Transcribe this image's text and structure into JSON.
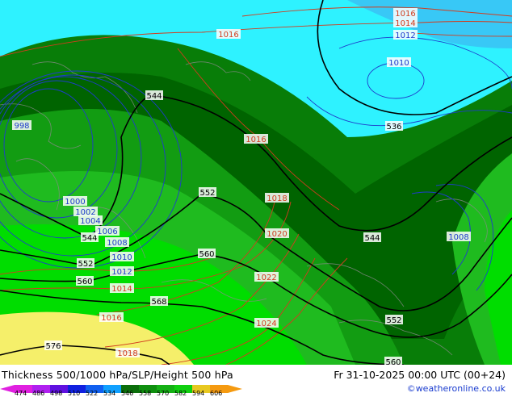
{
  "map": {
    "contour_labels_500hpa": [
      "544",
      "544",
      "544",
      "552",
      "552",
      "552",
      "560",
      "560",
      "560",
      "568",
      "576",
      "536"
    ],
    "contour_labels_slp": [
      "1016",
      "1016",
      "1016",
      "1014",
      "1014",
      "1012",
      "1012",
      "1010",
      "1010",
      "1008",
      "1008",
      "1008",
      "1006",
      "1004",
      "1002",
      "1000",
      "998",
      "1018",
      "1018",
      "1020",
      "1022",
      "1024"
    ],
    "colors": {
      "cyan": "#2ef2ff",
      "lightblue": "#38c8f6",
      "darkgreen": "#006400",
      "green1": "#087d08",
      "green2": "#129c12",
      "green3": "#1fbb1f",
      "lime": "#00dd00",
      "yellow": "#f5ef6a",
      "slp_red": "#d23c1e",
      "slp_blue": "#1f3ccc",
      "z500": "#000000"
    }
  },
  "footer": {
    "title": "Thickness 500/1000 hPa/SLP/Height 500 hPa",
    "valid_time": "Fr 31-10-2025 00:00 UTC (00+24)",
    "credit": "©weatheronline.co.uk",
    "scale_ticks": [
      "474",
      "486",
      "498",
      "510",
      "522",
      "534",
      "546",
      "558",
      "570",
      "582",
      "594",
      "606"
    ],
    "scale_colors": [
      "#e020e0",
      "#b020f0",
      "#6010e0",
      "#1020e0",
      "#1060f0",
      "#10a0ff",
      "#0b6e0b",
      "#0f8f0f",
      "#15b015",
      "#10d010",
      "#e8c820",
      "#f59a10"
    ]
  }
}
